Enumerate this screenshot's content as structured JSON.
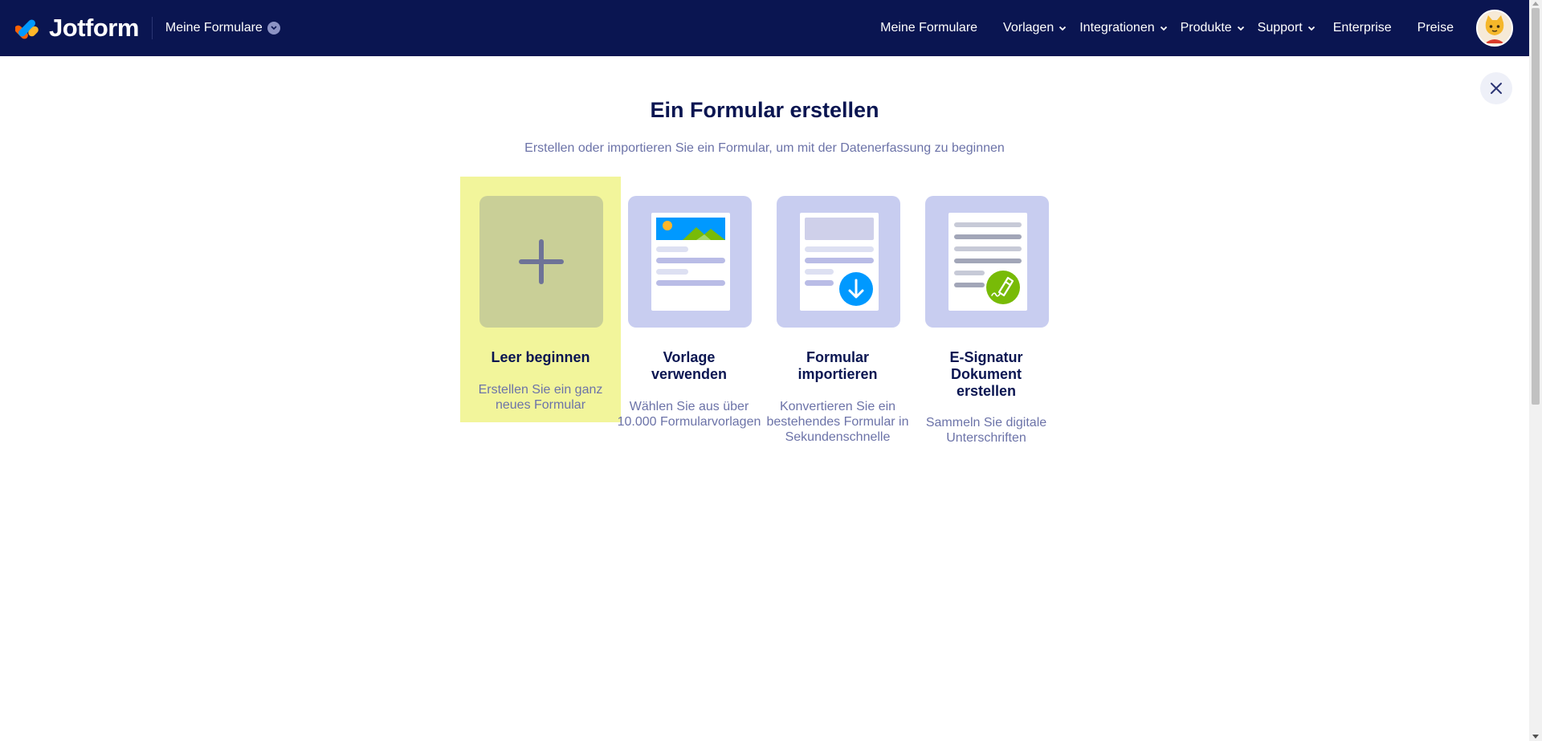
{
  "header": {
    "brand": "Jotform",
    "switcher_label": "Meine Formulare",
    "nav": [
      {
        "label": "Meine Formulare",
        "has_dropdown": false
      },
      {
        "label": "Vorlagen",
        "has_dropdown": true
      },
      {
        "label": "Integrationen",
        "has_dropdown": true
      },
      {
        "label": "Produkte",
        "has_dropdown": true
      },
      {
        "label": "Support",
        "has_dropdown": true
      },
      {
        "label": "Enterprise",
        "has_dropdown": false
      },
      {
        "label": "Preise",
        "has_dropdown": false
      }
    ]
  },
  "main": {
    "title": "Ein Formular erstellen",
    "subtitle": "Erstellen oder importieren Sie ein Formular, um mit der Datenerfassung zu beginnen"
  },
  "cards": [
    {
      "title": "Leer beginnen",
      "desc": "Erstellen Sie ein ganz neues Formular",
      "icon": "plus-icon",
      "selected": true
    },
    {
      "title": "Vorlage verwenden",
      "desc": "Wählen Sie aus über 10.000 Formularvorlagen",
      "icon": "template-icon",
      "selected": false
    },
    {
      "title": "Formular importieren",
      "desc": "Konvertieren Sie ein bestehendes Formular in Sekundenschnelle",
      "icon": "import-icon",
      "selected": false
    },
    {
      "title": "E-Signatur Dokument erstellen",
      "desc": "Sammeln Sie digitale Unterschriften",
      "icon": "signature-icon",
      "selected": false
    }
  ],
  "colors": {
    "header_bg": "#0a1551",
    "highlight": "#f2f59b",
    "card_bg": "#c8cdf0",
    "accent_blue": "#0099ff",
    "accent_green": "#78bb07"
  }
}
